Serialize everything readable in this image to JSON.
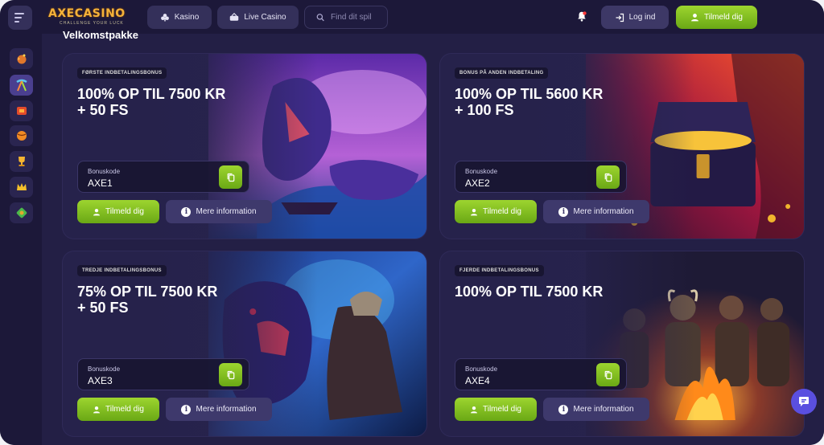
{
  "header": {
    "logo_text": "AXECASINO",
    "logo_tagline": "CHALLENGE YOUR LUCK",
    "nav": [
      {
        "label": "Kasino",
        "icon": "club-icon"
      },
      {
        "label": "Live Casino",
        "icon": "live-casino-icon"
      }
    ],
    "search_placeholder": "Find dit spil",
    "login_label": "Log ind",
    "signup_label": "Tilmeld dig"
  },
  "sidebar": {
    "items": [
      {
        "icon": "bomb-icon",
        "active": false
      },
      {
        "icon": "pickaxe-icon",
        "active": true
      },
      {
        "icon": "cherry-icon",
        "active": false
      },
      {
        "icon": "ball-icon",
        "active": false
      },
      {
        "icon": "trophy-icon",
        "active": false
      },
      {
        "icon": "crown-icon",
        "active": false
      },
      {
        "icon": "gem-icon",
        "active": false
      }
    ]
  },
  "main": {
    "section_title": "Velkomstpakke",
    "cards": [
      {
        "badge": "FØRSTE INDBETALINGSBONUS",
        "headline": "100% OP TIL 7500 KR\n+ 50 FS",
        "code_label": "Bonuskode",
        "code": "AXE1",
        "signup_label": "Tilmeld dig",
        "info_label": "Mere information",
        "art": "sea-dragon-illustration"
      },
      {
        "badge": "BONUS PÅ ANDEN INDBETALING",
        "headline": "100% OP TIL 5600 KR\n+ 100 FS",
        "code_label": "Bonuskode",
        "code": "AXE2",
        "signup_label": "Tilmeld dig",
        "info_label": "Mere information",
        "art": "treasure-chest-illustration"
      },
      {
        "badge": "TREDJE INDBETALINGSBONUS",
        "headline": "75% OP TIL 7500 KR\n+ 50 FS",
        "code_label": "Bonuskode",
        "code": "AXE3",
        "signup_label": "Tilmeld dig",
        "info_label": "Mere information",
        "art": "bear-viking-illustration"
      },
      {
        "badge": "FJERDE INDBETALINGSBONUS",
        "headline": "100% OP TIL 7500 KR",
        "code_label": "Bonuskode",
        "code": "AXE4",
        "signup_label": "Tilmeld dig",
        "info_label": "Mere information",
        "art": "vikings-campfire-illustration"
      }
    ]
  },
  "colors": {
    "accent_green": "#8cc824",
    "panel": "#2b2752",
    "background": "#1c1839"
  }
}
